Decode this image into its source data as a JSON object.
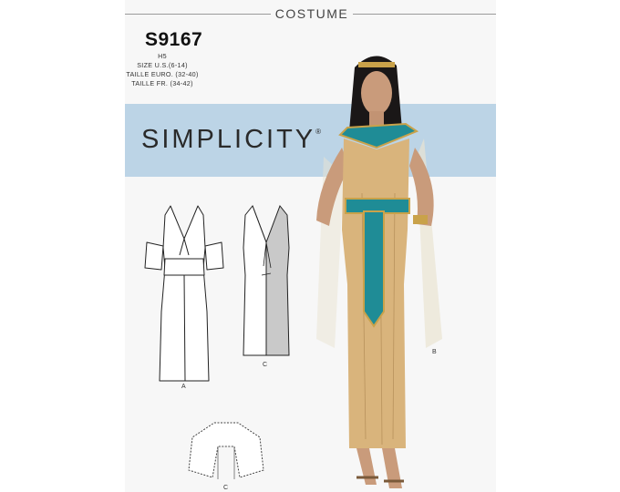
{
  "header": {
    "category": "COSTUME"
  },
  "pattern": {
    "number": "S9167",
    "size_code": "H5",
    "sizes": [
      "SIZE U.S.(6-14)",
      "TAILLE EURO. (32-40)",
      "TAILLE FR. (34-42)"
    ]
  },
  "brand": {
    "name": "SIMPLICITY",
    "mark": "®"
  },
  "views": [
    {
      "id": "view-a",
      "label": "A"
    },
    {
      "id": "view-c-dress",
      "label": "C"
    },
    {
      "id": "view-c-capelet",
      "label": "C"
    },
    {
      "id": "view-b-model",
      "label": "B"
    }
  ],
  "colors": {
    "band": "#bcd4e6",
    "gown": "#d9b47c",
    "collar_teal": "#1f8c96",
    "gold": "#c9a24a"
  }
}
